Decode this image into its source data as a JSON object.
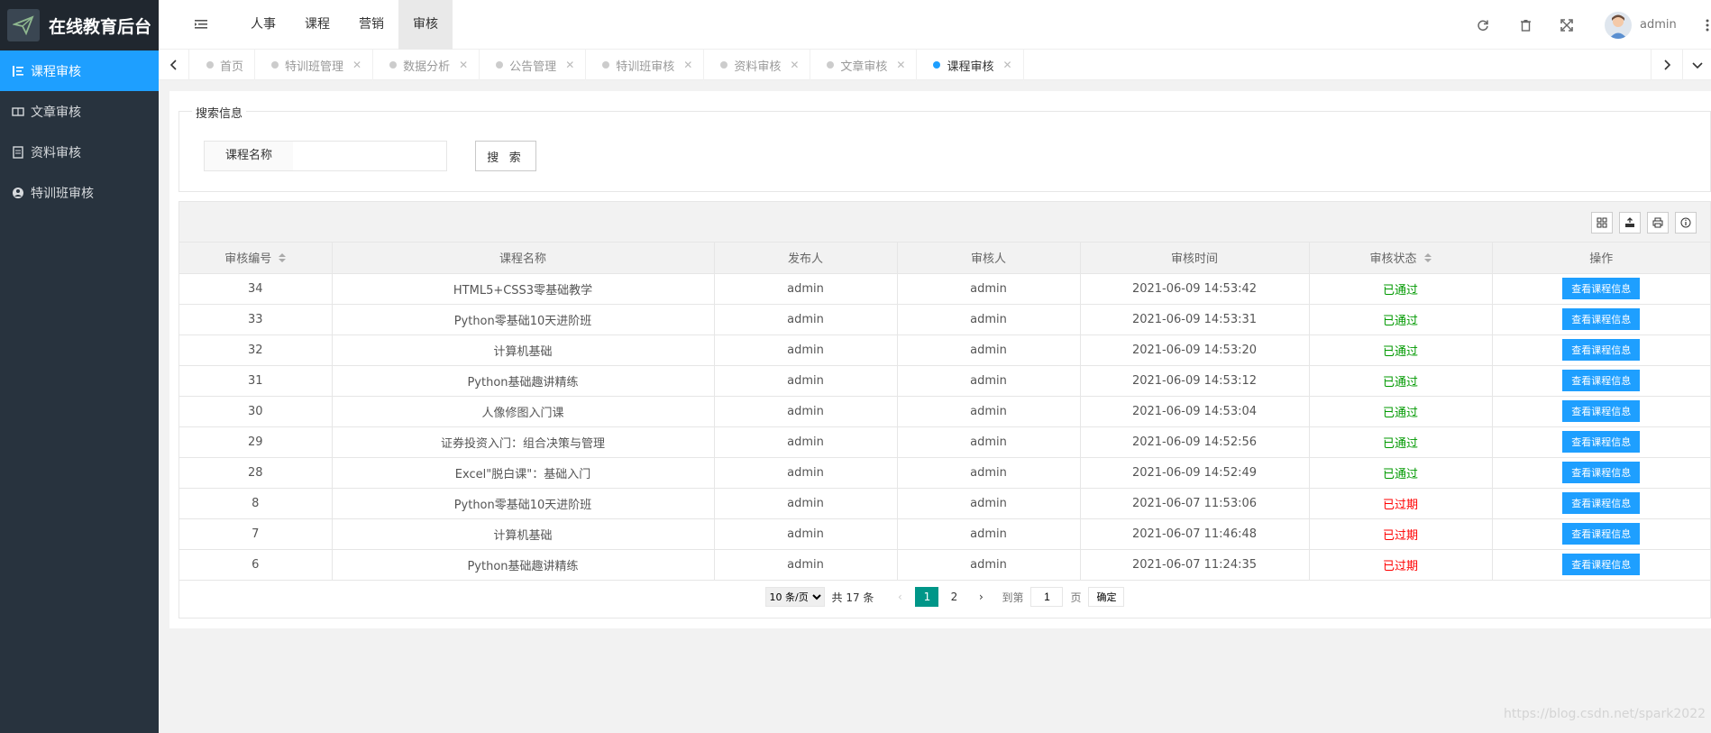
{
  "app": {
    "title": "在线教育后台"
  },
  "sidebar": {
    "items": [
      {
        "label": "课程审核",
        "icon": "list-icon",
        "active": true
      },
      {
        "label": "文章审核",
        "icon": "book-icon",
        "active": false
      },
      {
        "label": "资料审核",
        "icon": "document-icon",
        "active": false
      },
      {
        "label": "特训班审核",
        "icon": "group-icon",
        "active": false
      }
    ]
  },
  "header": {
    "nav": [
      "人事",
      "课程",
      "营销",
      "审核"
    ],
    "active_nav": "审核",
    "user": "admin"
  },
  "tabs": [
    {
      "label": "首页",
      "active": false
    },
    {
      "label": "特训班管理",
      "active": false
    },
    {
      "label": "数据分析",
      "active": false
    },
    {
      "label": "公告管理",
      "active": false
    },
    {
      "label": "特训班审核",
      "active": false
    },
    {
      "label": "资料审核",
      "active": false
    },
    {
      "label": "文章审核",
      "active": false
    },
    {
      "label": "课程审核",
      "active": true
    }
  ],
  "search": {
    "legend": "搜索信息",
    "label": "课程名称",
    "value": "",
    "button": "搜 索"
  },
  "table": {
    "columns": [
      "审核编号",
      "课程名称",
      "发布人",
      "审核人",
      "审核时间",
      "审核状态",
      "操作"
    ],
    "rows": [
      {
        "id": "34",
        "name": "HTML5+CSS3零基础教学",
        "publisher": "admin",
        "reviewer": "admin",
        "time": "2021-06-09 14:53:42",
        "status": "已通过",
        "op": "查看课程信息"
      },
      {
        "id": "33",
        "name": "Python零基础10天进阶班",
        "publisher": "admin",
        "reviewer": "admin",
        "time": "2021-06-09 14:53:31",
        "status": "已通过",
        "op": "查看课程信息"
      },
      {
        "id": "32",
        "name": "计算机基础",
        "publisher": "admin",
        "reviewer": "admin",
        "time": "2021-06-09 14:53:20",
        "status": "已通过",
        "op": "查看课程信息"
      },
      {
        "id": "31",
        "name": "Python基础趣讲精练",
        "publisher": "admin",
        "reviewer": "admin",
        "time": "2021-06-09 14:53:12",
        "status": "已通过",
        "op": "查看课程信息"
      },
      {
        "id": "30",
        "name": "人像修图入门课",
        "publisher": "admin",
        "reviewer": "admin",
        "time": "2021-06-09 14:53:04",
        "status": "已通过",
        "op": "查看课程信息"
      },
      {
        "id": "29",
        "name": "证券投资入门：组合决策与管理",
        "publisher": "admin",
        "reviewer": "admin",
        "time": "2021-06-09 14:52:56",
        "status": "已通过",
        "op": "查看课程信息"
      },
      {
        "id": "28",
        "name": "Excel\"脱白课\"：基础入门",
        "publisher": "admin",
        "reviewer": "admin",
        "time": "2021-06-09 14:52:49",
        "status": "已通过",
        "op": "查看课程信息"
      },
      {
        "id": "8",
        "name": "Python零基础10天进阶班",
        "publisher": "admin",
        "reviewer": "admin",
        "time": "2021-06-07 11:53:06",
        "status": "已过期",
        "op": "查看课程信息"
      },
      {
        "id": "7",
        "name": "计算机基础",
        "publisher": "admin",
        "reviewer": "admin",
        "time": "2021-06-07 11:46:48",
        "status": "已过期",
        "op": "查看课程信息"
      },
      {
        "id": "6",
        "name": "Python基础趣讲精练",
        "publisher": "admin",
        "reviewer": "admin",
        "time": "2021-06-07 11:24:35",
        "status": "已过期",
        "op": "查看课程信息"
      }
    ]
  },
  "pager": {
    "page_size": "10 条/页",
    "total": "共 17 条",
    "pages": [
      "1",
      "2"
    ],
    "current": "1",
    "goto_prefix": "到第",
    "goto_value": "1",
    "goto_suffix": "页",
    "confirm": "确定"
  },
  "watermark": "https://blog.csdn.net/spark2022",
  "colors": {
    "primary": "#1e9fff",
    "sidebar": "#28333e",
    "pass": "#009900",
    "expired": "#ff0000",
    "page_active": "#009688"
  }
}
